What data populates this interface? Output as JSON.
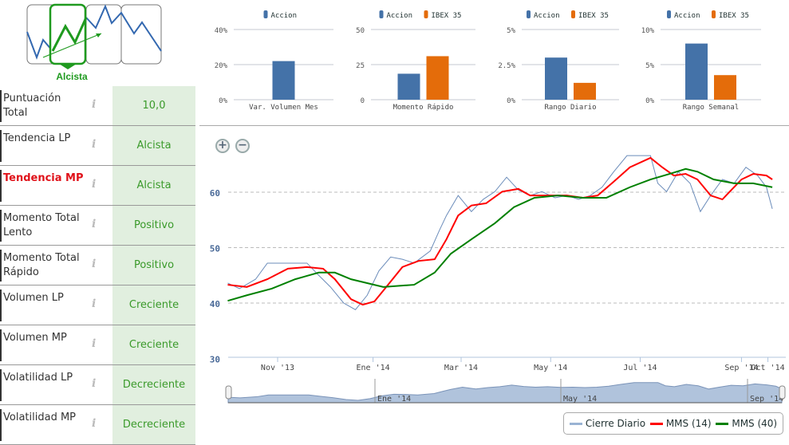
{
  "header": {
    "trend_label": "Alcista"
  },
  "score_rows": [
    {
      "label": "Puntuación Total",
      "value": "10,0",
      "active": false
    },
    {
      "label": "Tendencia LP",
      "value": "Alcista",
      "active": false
    },
    {
      "label": "Tendencia MP",
      "value": "Alcista",
      "active": true
    },
    {
      "label": "Momento Total Lento",
      "value": "Positivo",
      "active": false
    },
    {
      "label": "Momento Total Rápido",
      "value": "Positivo",
      "active": false
    },
    {
      "label": "Volumen LP",
      "value": "Creciente",
      "active": false
    },
    {
      "label": "Volumen MP",
      "value": "Creciente",
      "active": false
    },
    {
      "label": "Volatilidad LP",
      "value": "Decreciente",
      "active": false
    },
    {
      "label": "Volatilidad MP",
      "value": "Decreciente",
      "active": false
    }
  ],
  "info_icon": "i",
  "colors": {
    "accion": "#4472a8",
    "ibex": "#e46c0a",
    "cierre": "#6b8cba",
    "mms14": "#ff0000",
    "mms40": "#008000",
    "green": "#3a9a2a"
  },
  "chart_data": [
    {
      "type": "bar",
      "title": "Var. Volumen Mes",
      "series": [
        {
          "name": "Accion",
          "values": [
            22
          ]
        }
      ],
      "yticks": [
        "0%",
        "20%",
        "40%"
      ],
      "ylim": [
        0,
        40
      ]
    },
    {
      "type": "bar",
      "title": "Momento Rápido",
      "series": [
        {
          "name": "Accion",
          "values": [
            18.5
          ]
        },
        {
          "name": "IBEX 35",
          "values": [
            31
          ]
        }
      ],
      "yticks": [
        "0",
        "25",
        "50"
      ],
      "ylim": [
        0,
        50
      ]
    },
    {
      "type": "bar",
      "title": "Rango Diario",
      "series": [
        {
          "name": "Accion",
          "values": [
            3.0
          ]
        },
        {
          "name": "IBEX 35",
          "values": [
            1.2
          ]
        }
      ],
      "yticks": [
        "0%",
        "2.5%",
        "5%"
      ],
      "ylim": [
        0,
        5
      ]
    },
    {
      "type": "bar",
      "title": "Rango Semanal",
      "series": [
        {
          "name": "Accion",
          "values": [
            8
          ]
        },
        {
          "name": "IBEX 35",
          "values": [
            3.5
          ]
        }
      ],
      "yticks": [
        "0%",
        "5%",
        "10%"
      ],
      "ylim": [
        0,
        10
      ]
    },
    {
      "type": "line",
      "x_unit": "days since 1 Nov 2013",
      "ylim": [
        30,
        68
      ],
      "yticks": [
        "30",
        "40",
        "50",
        "60"
      ],
      "xticks": [
        {
          "label": "Nov '13",
          "d": 0
        },
        {
          "label": "Ene '14",
          "d": 65
        },
        {
          "label": "Mar '14",
          "d": 125
        },
        {
          "label": "May '14",
          "d": 186
        },
        {
          "label": "Jul '14",
          "d": 247
        },
        {
          "label": "Sep '14",
          "d": 316
        },
        {
          "label": "Oct '14",
          "d": 334
        }
      ],
      "navigator_ticks": [
        {
          "label": "Ene '14",
          "d": 65
        },
        {
          "label": "May '14",
          "d": 186
        },
        {
          "label": "Sep '14",
          "d": 316
        }
      ],
      "series": [
        {
          "name": "Cierre Diario",
          "points": [
            [
              -34,
              43.6
            ],
            [
              -26,
              42.6
            ],
            [
              -15,
              44.3
            ],
            [
              -7,
              47.2
            ],
            [
              7,
              47.2
            ],
            [
              20,
              47.2
            ],
            [
              28,
              45.0
            ],
            [
              36,
              42.9
            ],
            [
              45,
              40.0
            ],
            [
              53,
              38.8
            ],
            [
              61,
              41.4
            ],
            [
              69,
              45.8
            ],
            [
              77,
              48.3
            ],
            [
              85,
              47.9
            ],
            [
              93,
              47.2
            ],
            [
              104,
              49.4
            ],
            [
              110,
              53.0
            ],
            [
              115,
              55.8
            ],
            [
              123,
              59.4
            ],
            [
              132,
              56.5
            ],
            [
              140,
              58.7
            ],
            [
              148,
              60.1
            ],
            [
              156,
              62.7
            ],
            [
              164,
              60.4
            ],
            [
              172,
              59.4
            ],
            [
              180,
              60.1
            ],
            [
              189,
              59.0
            ],
            [
              197,
              59.4
            ],
            [
              205,
              58.7
            ],
            [
              213,
              59.4
            ],
            [
              221,
              60.9
            ],
            [
              229,
              63.7
            ],
            [
              238,
              66.6
            ],
            [
              246,
              66.6
            ],
            [
              254,
              66.6
            ],
            [
              259,
              61.6
            ],
            [
              265,
              60.1
            ],
            [
              273,
              63.7
            ],
            [
              281,
              61.6
            ],
            [
              288,
              56.5
            ],
            [
              295,
              59.4
            ],
            [
              303,
              62.3
            ],
            [
              311,
              61.6
            ],
            [
              319,
              64.5
            ],
            [
              327,
              63.0
            ],
            [
              333,
              60.9
            ],
            [
              337,
              57.0
            ]
          ]
        },
        {
          "name": "MMS (14)",
          "points": [
            [
              -34,
              43.3
            ],
            [
              -21,
              42.9
            ],
            [
              -7,
              44.3
            ],
            [
              7,
              46.2
            ],
            [
              20,
              46.5
            ],
            [
              31,
              46.2
            ],
            [
              39,
              44.3
            ],
            [
              50,
              40.7
            ],
            [
              58,
              39.7
            ],
            [
              66,
              40.3
            ],
            [
              74,
              42.9
            ],
            [
              85,
              46.5
            ],
            [
              96,
              47.6
            ],
            [
              107,
              47.9
            ],
            [
              115,
              51.5
            ],
            [
              123,
              55.8
            ],
            [
              132,
              57.6
            ],
            [
              142,
              58.0
            ],
            [
              153,
              60.1
            ],
            [
              164,
              60.6
            ],
            [
              172,
              59.4
            ],
            [
              186,
              59.4
            ],
            [
              197,
              59.4
            ],
            [
              208,
              59.0
            ],
            [
              218,
              59.4
            ],
            [
              229,
              61.9
            ],
            [
              240,
              64.5
            ],
            [
              254,
              66.2
            ],
            [
              262,
              64.5
            ],
            [
              270,
              63.0
            ],
            [
              278,
              63.3
            ],
            [
              286,
              62.3
            ],
            [
              295,
              59.4
            ],
            [
              303,
              58.7
            ],
            [
              308,
              60.1
            ],
            [
              316,
              62.3
            ],
            [
              324,
              63.3
            ],
            [
              333,
              63.0
            ],
            [
              337,
              62.3
            ]
          ]
        },
        {
          "name": "MMS (40)",
          "points": [
            [
              -34,
              40.4
            ],
            [
              -21,
              41.4
            ],
            [
              -4,
              42.6
            ],
            [
              12,
              44.3
            ],
            [
              28,
              45.5
            ],
            [
              39,
              45.5
            ],
            [
              50,
              44.3
            ],
            [
              61,
              43.6
            ],
            [
              72,
              42.9
            ],
            [
              93,
              43.3
            ],
            [
              107,
              45.5
            ],
            [
              118,
              48.9
            ],
            [
              132,
              51.5
            ],
            [
              148,
              54.4
            ],
            [
              161,
              57.3
            ],
            [
              175,
              59.0
            ],
            [
              191,
              59.4
            ],
            [
              208,
              59.0
            ],
            [
              224,
              59.0
            ],
            [
              240,
              60.9
            ],
            [
              254,
              62.3
            ],
            [
              267,
              63.3
            ],
            [
              278,
              64.2
            ],
            [
              286,
              63.7
            ],
            [
              297,
              62.3
            ],
            [
              311,
              61.6
            ],
            [
              324,
              61.6
            ],
            [
              337,
              60.9
            ]
          ]
        }
      ]
    }
  ],
  "legend": {
    "accion": "Accion",
    "ibex": "IBEX 35",
    "cierre": "Cierre Diario",
    "mms14": "MMS (14)",
    "mms40": "MMS (40)"
  },
  "zoom": {
    "in": "+",
    "out": "−"
  }
}
